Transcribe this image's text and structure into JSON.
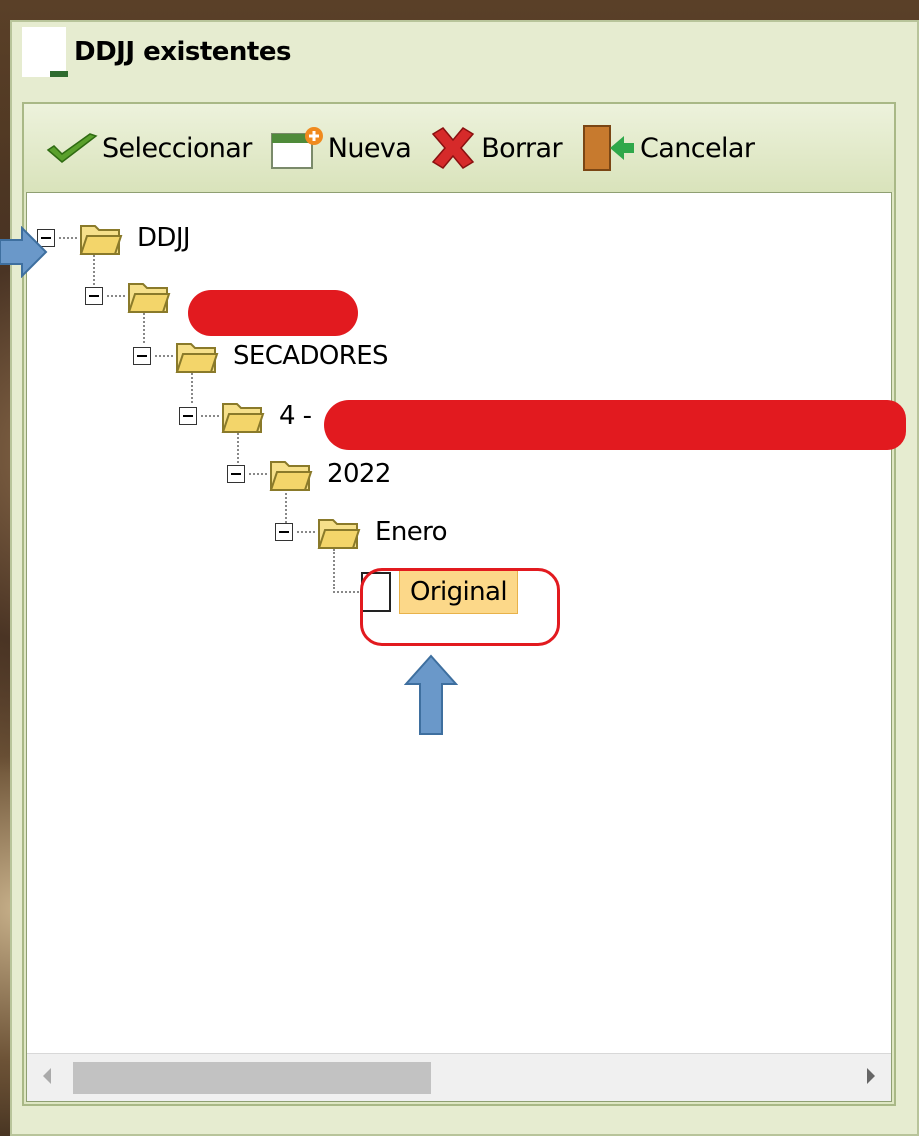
{
  "window": {
    "title": "DDJJ existentes"
  },
  "toolbar": {
    "select_label": "Seleccionar",
    "new_label": "Nueva",
    "delete_label": "Borrar",
    "cancel_label": "Cancelar"
  },
  "tree": {
    "root": "DDJJ",
    "level2": "",
    "level3": "SECADORES",
    "level4_prefix": "4 -",
    "year": "2022",
    "month": "Enero",
    "leaf": "Original"
  },
  "colors": {
    "window_bg": "#e6ecd0",
    "selection": "#fcd889",
    "redaction": "#e21a1f",
    "annotation_arrow": "#6a98c9"
  }
}
